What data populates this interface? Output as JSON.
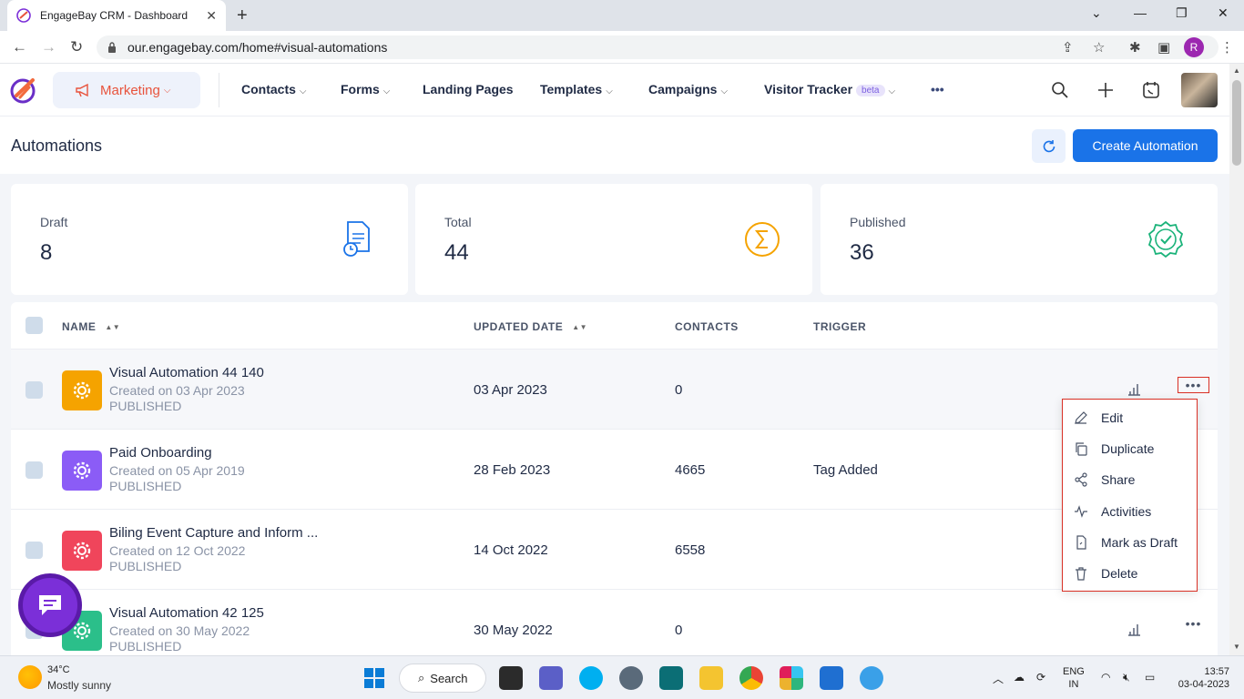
{
  "browser": {
    "tab_title": "EngageBay CRM - Dashboard",
    "url": "our.engagebay.com/home#visual-automations",
    "profile_initial": "R"
  },
  "header": {
    "module_label": "Marketing",
    "nav": [
      {
        "label": "Contacts",
        "has_dropdown": true
      },
      {
        "label": "Forms",
        "has_dropdown": true
      },
      {
        "label": "Landing Pages",
        "has_dropdown": false
      },
      {
        "label": "Templates",
        "has_dropdown": true
      },
      {
        "label": "Campaigns",
        "has_dropdown": true
      },
      {
        "label": "Visitor Tracker",
        "has_dropdown": true,
        "badge": "beta"
      }
    ],
    "more_label": "•••"
  },
  "page": {
    "title": "Automations",
    "create_button": "Create Automation"
  },
  "stats": [
    {
      "label": "Draft",
      "value": "8",
      "icon": "draft-doc-icon",
      "color": "#1a73e8"
    },
    {
      "label": "Total",
      "value": "44",
      "icon": "sigma-icon",
      "color": "#f5a300"
    },
    {
      "label": "Published",
      "value": "36",
      "icon": "verified-badge-icon",
      "color": "#1bb37a"
    }
  ],
  "table": {
    "columns": {
      "name": "NAME",
      "updated": "UPDATED DATE",
      "contacts": "CONTACTS",
      "trigger": "TRIGGER"
    },
    "rows": [
      {
        "name": "Visual Automation 44 140",
        "created": "Created on 03 Apr 2023",
        "status": "PUBLISHED",
        "updated": "03 Apr 2023",
        "contacts": "0",
        "trigger": "",
        "icon_color": "#f5a300"
      },
      {
        "name": "Paid Onboarding",
        "created": "Created on 05 Apr 2019",
        "status": "PUBLISHED",
        "updated": "28 Feb 2023",
        "contacts": "4665",
        "trigger": "Tag Added",
        "icon_color": "#8b5cf6"
      },
      {
        "name": "Biling Event Capture and Inform ...",
        "created": "Created on 12 Oct 2022",
        "status": "PUBLISHED",
        "updated": "14 Oct 2022",
        "contacts": "6558",
        "trigger": "",
        "icon_color": "#f0455b"
      },
      {
        "name": "Visual Automation 42 125",
        "created": "Created on 30 May 2022",
        "status": "PUBLISHED",
        "updated": "30 May 2022",
        "contacts": "0",
        "trigger": "",
        "icon_color": "#2bbf8a"
      }
    ]
  },
  "row_menu": {
    "items": [
      "Edit",
      "Duplicate",
      "Share",
      "Activities",
      "Mark as Draft",
      "Delete"
    ]
  },
  "taskbar": {
    "temperature": "34°C",
    "weather": "Mostly sunny",
    "search_label": "Search",
    "lang_line1": "ENG",
    "lang_line2": "IN",
    "time": "13:57",
    "date": "03-04-2023"
  }
}
